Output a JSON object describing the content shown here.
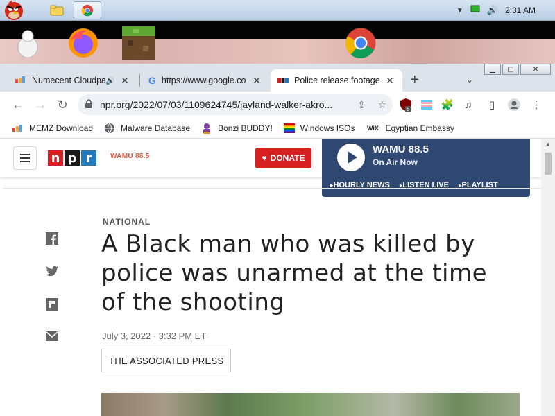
{
  "taskbar": {
    "clock": "2:31 AM"
  },
  "tabs": [
    {
      "title": "Numecent Cloudpa",
      "active": false
    },
    {
      "title": "https://www.google.co",
      "active": false
    },
    {
      "title": "Police release footage",
      "active": true
    }
  ],
  "toolbar": {
    "url": "npr.org/2022/07/03/1109624745/jayland-walker-akro...",
    "extension_badge": "5"
  },
  "bookmarks": [
    {
      "label": "MEMZ Download",
      "icon": "memz-icon"
    },
    {
      "label": "Malware Database",
      "icon": "globe-icon"
    },
    {
      "label": "Bonzi BUDDY!",
      "icon": "bonzi-icon"
    },
    {
      "label": "Windows ISOs",
      "icon": "rainbow-flag-icon"
    },
    {
      "label": "Egyptian Embassy",
      "icon": "wix-icon"
    }
  ],
  "npr": {
    "logo_letters": [
      "n",
      "p",
      "r"
    ],
    "station_logo": "WAMU 88.5",
    "donate": "DONATE",
    "player": {
      "station": "WAMU 88.5",
      "status": "On Air Now",
      "links": [
        "HOURLY NEWS",
        "LISTEN LIVE",
        "PLAYLIST"
      ]
    }
  },
  "article": {
    "section": "NATIONAL",
    "headline": "A Black man who was killed by police was unarmed at the time of the shooting",
    "date": "July 3, 2022 · 3:32 PM ET",
    "byline": "THE ASSOCIATED PRESS"
  },
  "colors": {
    "npr_red": "#d62021",
    "npr_black": "#1a1a1a",
    "npr_blue": "#237bbd",
    "player_bg": "#2f4872"
  }
}
